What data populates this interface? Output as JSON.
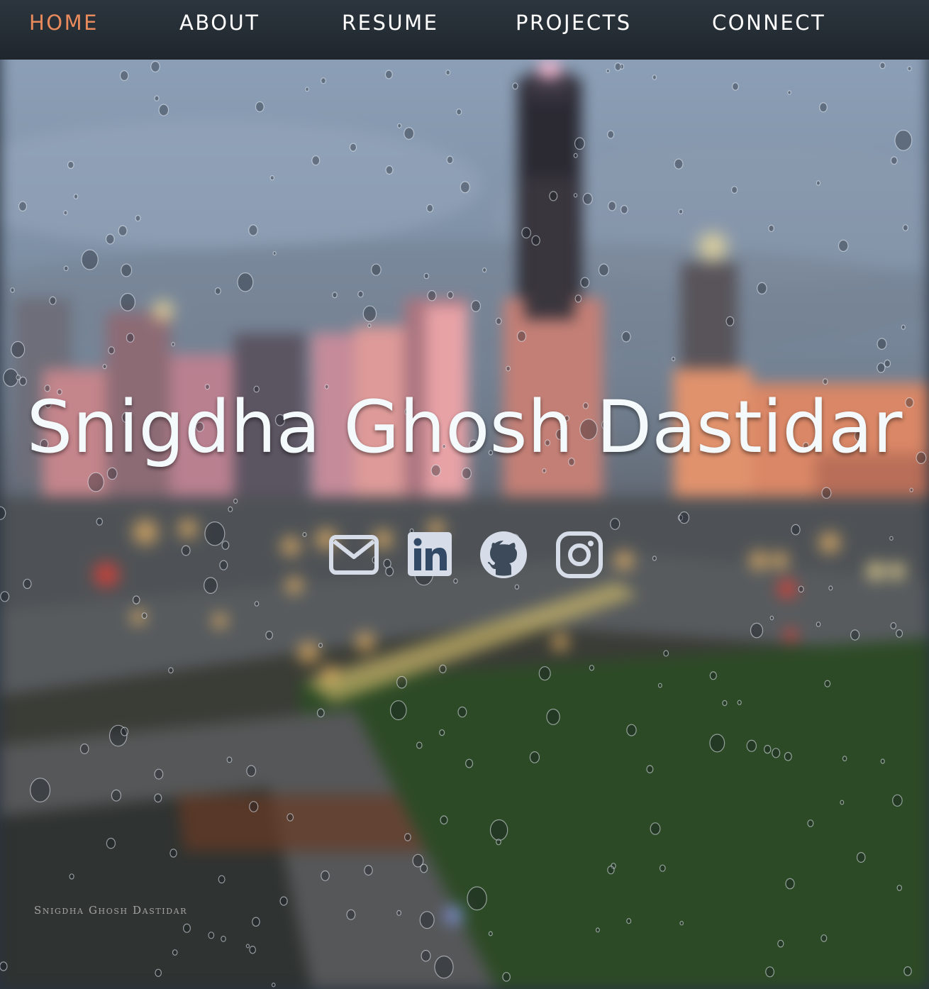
{
  "nav": {
    "items": [
      {
        "label": "HOME",
        "active": true
      },
      {
        "label": "ABOUT",
        "active": false
      },
      {
        "label": "RESUME",
        "active": false
      },
      {
        "label": "PROJECTS",
        "active": false
      },
      {
        "label": "CONNECT",
        "active": false
      }
    ]
  },
  "hero": {
    "name": "Snigdha Ghosh Dastidar",
    "social": [
      {
        "icon": "envelope-icon"
      },
      {
        "icon": "linkedin-icon"
      },
      {
        "icon": "github-icon"
      },
      {
        "icon": "instagram-icon"
      }
    ]
  },
  "photo": {
    "watermark": "Snigdha Ghosh Dastidar"
  },
  "colors": {
    "nav_active": "#e98a5c",
    "nav_text": "#ffffff",
    "title": "#f4f9fb",
    "icon_fill": "#d7dde8"
  }
}
